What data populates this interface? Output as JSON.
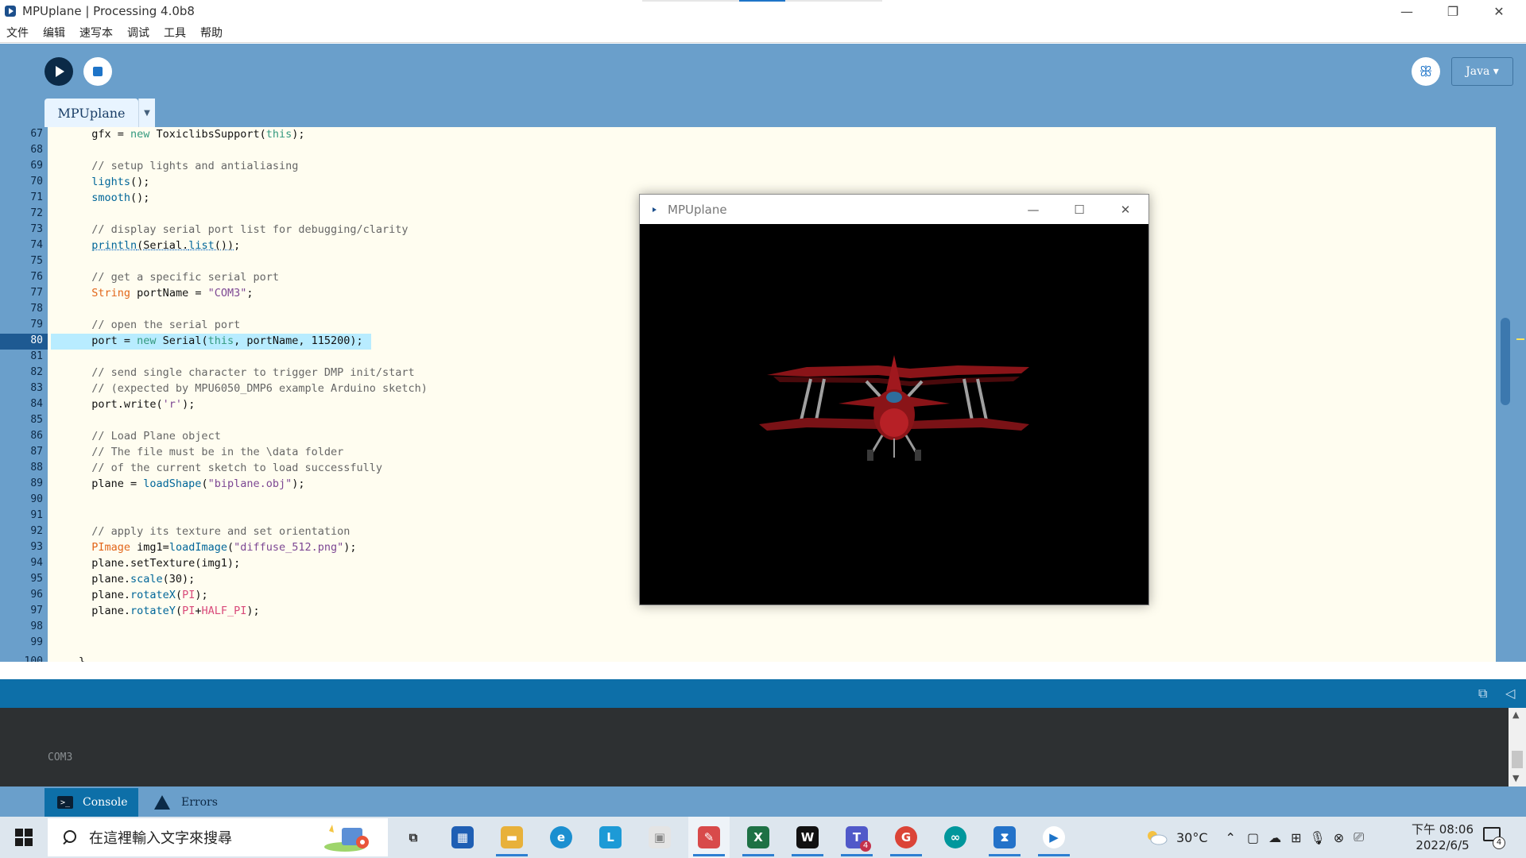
{
  "window": {
    "title": "MPUplane | Processing 4.0b8",
    "minimize_glyph": "—",
    "restore_glyph": "❐",
    "close_glyph": "✕"
  },
  "menu": [
    "文件",
    "编辑",
    "速写本",
    "调试",
    "工具",
    "帮助"
  ],
  "toolbar": {
    "run_label": "Run",
    "stop_label": "Stop",
    "mode_label": "Java ▾",
    "debug_glyph": "ꕥ"
  },
  "editor": {
    "tab_name": "MPUplane",
    "tab_menu_glyph": "▼",
    "active_line": 80,
    "line_numbers": [
      "67",
      "68",
      "69",
      "70",
      "71",
      "72",
      "73",
      "74",
      "75",
      "76",
      "77",
      "78",
      "79",
      "80",
      "81",
      "82",
      "83",
      "84",
      "85",
      "86",
      "87",
      "88",
      "89",
      "90",
      "91",
      "92",
      "93",
      "94",
      "95",
      "96",
      "97",
      "98",
      "99",
      "100"
    ],
    "code_lines": [
      "  gfx = new ToxiclibsSupport(this);",
      "",
      "  // setup lights and antialiasing",
      "  lights();",
      "  smooth();",
      "",
      "  // display serial port list for debugging/clarity",
      "  println(Serial.list());",
      "",
      "  // get a specific serial port",
      "  String portName = \"COM3\";",
      "",
      "  // open the serial port",
      "  port = new Serial(this, portName, 115200);",
      "",
      "  // send single character to trigger DMP init/start",
      "  // (expected by MPU6050_DMP6 example Arduino sketch)",
      "  port.write('r');",
      "",
      "  // Load Plane object",
      "  // The file must be in the \\data folder",
      "  // of the current sketch to load successfully",
      "  plane = loadShape(\"biplane.obj\");",
      "",
      "",
      "  // apply its texture and set orientation",
      "  PImage img1=loadImage(\"diffuse_512.png\");",
      "  plane.setTexture(img1);",
      "  plane.scale(30);",
      "  plane.rotateX(PI);",
      "  plane.rotateY(PI+HALF_PI);",
      "",
      "",
      "}"
    ]
  },
  "status": {
    "copy_glyph": "⧉",
    "collapse_glyph": "◁"
  },
  "console": {
    "output": "COM3",
    "scroll_up": "▲",
    "scroll_down": "▼"
  },
  "bottom_tabs": {
    "console_label": "Console",
    "errors_label": "Errors",
    "console_icon": ">_"
  },
  "sketch_window": {
    "title": "MPUplane",
    "minimize_glyph": "—",
    "maximize_glyph": "☐",
    "close_glyph": "✕"
  },
  "taskbar": {
    "search_placeholder": "在這裡輸入文字來搜尋",
    "apps": [
      {
        "name": "task-view",
        "glyph": "⧉",
        "color": "#2b2b2b",
        "bg": "transparent"
      },
      {
        "name": "microsoft-store",
        "glyph": "▦",
        "color": "#ffffff",
        "bg": "#1f5fb4"
      },
      {
        "name": "file-explorer",
        "glyph": "▬",
        "color": "#ffffff",
        "bg": "#e8b13a"
      },
      {
        "name": "edge",
        "glyph": "e",
        "color": "#ffffff",
        "bg": "#1b8fd0"
      },
      {
        "name": "line-app",
        "glyph": "L",
        "color": "#ffffff",
        "bg": "#1d9ad6"
      },
      {
        "name": "photos",
        "glyph": "▣",
        "color": "#888888",
        "bg": "#e4e4e4"
      },
      {
        "name": "paint-app",
        "glyph": "✎",
        "color": "#ffffff",
        "bg": "#d84a4a"
      },
      {
        "name": "excel",
        "glyph": "X",
        "color": "#ffffff",
        "bg": "#1e7145"
      },
      {
        "name": "webex",
        "glyph": "W",
        "color": "#ffffff",
        "bg": "#111111"
      },
      {
        "name": "teams",
        "glyph": "T",
        "color": "#ffffff",
        "bg": "#5059c9"
      },
      {
        "name": "chrome",
        "glyph": "G",
        "color": "#ffffff",
        "bg": "#db4437"
      },
      {
        "name": "arduino",
        "glyph": "∞",
        "color": "#ffffff",
        "bg": "#00979c"
      },
      {
        "name": "vscode-app",
        "glyph": "⧗",
        "color": "#ffffff",
        "bg": "#2372c9"
      },
      {
        "name": "processing",
        "glyph": "▶",
        "color": "#1e74c8",
        "bg": "#ffffff"
      }
    ],
    "teams_badge": "4",
    "weather": "30°C",
    "tray_glyphs": [
      "⌃",
      "▢",
      "☁",
      "⊞",
      "🎙",
      "⊗",
      "⎚"
    ],
    "time": "下午 08:06",
    "date": "2022/6/5",
    "notif_count": "4"
  }
}
